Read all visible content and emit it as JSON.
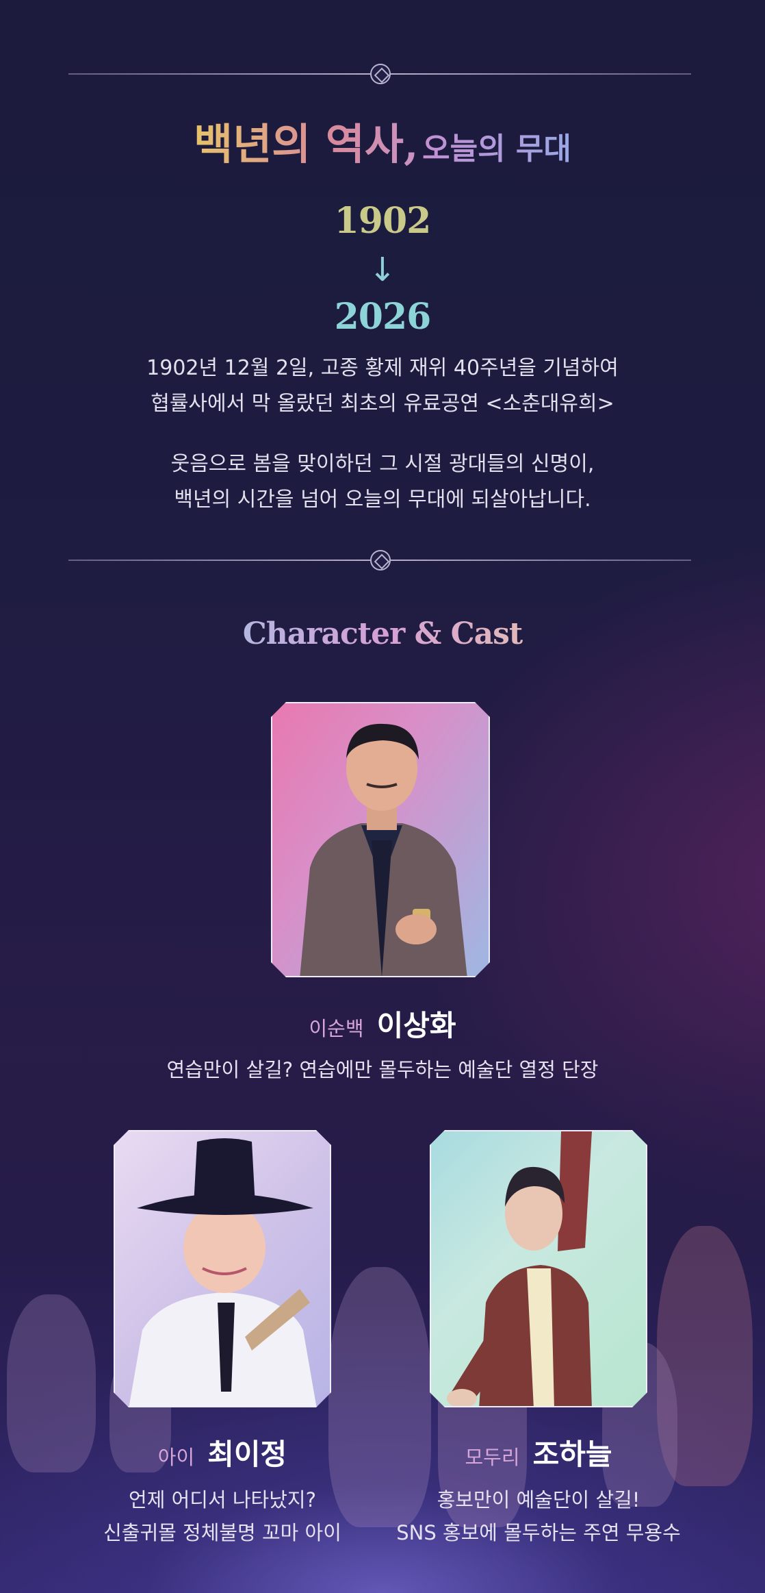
{
  "history": {
    "title_big": "백년의 역사,",
    "title_small": "오늘의 무대",
    "year_start": "1902",
    "arrow": "↓",
    "year_end": "2026",
    "paragraph1": [
      "1902년 12월 2일, 고종 황제 재위 40주년을 기념하여",
      "협률사에서 막 올랐던 최초의 유료공연 <소춘대유희>"
    ],
    "paragraph2": [
      "웃음으로 봄을 맞이하던 그 시절 광대들의 신명이,",
      "백년의 시간을 넘어 오늘의 무대에 되살아납니다."
    ]
  },
  "cast_section": {
    "title": "Character & Cast",
    "members": [
      {
        "role": "이순백",
        "name": "이상화",
        "description": [
          "연습만이 살길? 연습에만 몰두하는 예술단 열정 단장"
        ]
      },
      {
        "role": "아이",
        "name": "최이정",
        "description": [
          "언제 어디서 나타났지?",
          "신출귀몰 정체불명 꼬마 아이"
        ]
      },
      {
        "role": "모두리",
        "name": "조하늘",
        "description": [
          "홍보만이 예술단이 살길!",
          "SNS 홍보에 몰두하는 주연 무용수"
        ]
      }
    ]
  }
}
